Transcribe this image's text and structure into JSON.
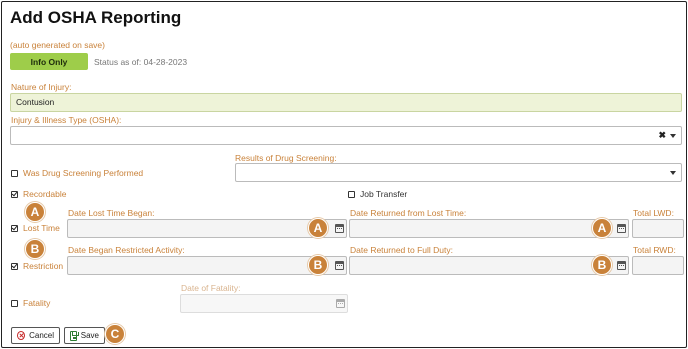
{
  "header": {
    "title": "Add OSHA Reporting",
    "auto_generated_note": "(auto generated on save)",
    "status_button": "Info Only",
    "status_as_of": "Status as of: 04-28-2023"
  },
  "fields": {
    "nature_of_injury": {
      "label": "Nature of Injury:",
      "value": "Contusion"
    },
    "injury_illness_type": {
      "label": "Injury & Illness Type (OSHA):",
      "value": ""
    },
    "drug_screening": {
      "checkbox_label": "Was Drug Screening Performed",
      "checked": false
    },
    "drug_screening_results": {
      "label": "Results of Drug Screening:",
      "value": ""
    },
    "recordable": {
      "label": "Recordable",
      "checked": true
    },
    "job_transfer": {
      "label": "Job Transfer",
      "checked": false
    },
    "lost_time": {
      "label": "Lost Time",
      "checked": true,
      "date_began_label": "Date Lost Time Began:",
      "date_returned_label": "Date Returned from Lost Time:",
      "total_label": "Total LWD:"
    },
    "restriction": {
      "label": "Restriction",
      "checked": true,
      "date_began_label": "Date Began Restricted Activity:",
      "date_returned_label": "Date Returned to Full Duty:",
      "total_label": "Total RWD:"
    },
    "fatality": {
      "label": "Fatality",
      "checked": false,
      "date_label": "Date of Fatality:"
    }
  },
  "callouts": {
    "a": "A",
    "b": "B",
    "c": "C"
  },
  "footer": {
    "cancel_label": "Cancel",
    "save_label": "Save"
  },
  "icons": {
    "calendar": "calendar-icon",
    "dropdown": "chevron-down-icon",
    "clear": "clear-x-icon",
    "cancel": "cancel-circle-icon",
    "save": "floppy-disk-icon"
  },
  "colors": {
    "accent": "#c9823a",
    "status_green": "#9ecd4a",
    "field_green": "#eef3d8",
    "cancel_red": "#c62828",
    "save_green": "#2e7d32"
  }
}
